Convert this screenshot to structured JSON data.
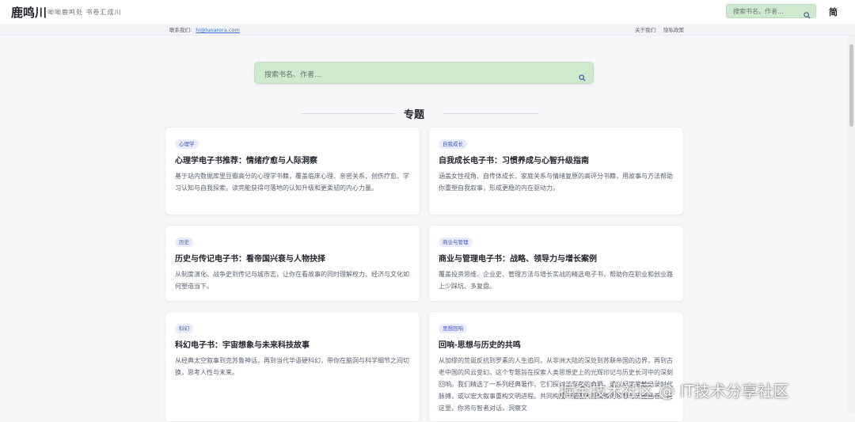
{
  "header": {
    "logo": "鹿鸣川",
    "tagline": "呦呦鹿鸣处 书卷汇成川",
    "search_placeholder": "搜索书名、作者...",
    "lang": "简"
  },
  "subbar": {
    "contact_label": "联系我们:",
    "email": "hi@lunarora.com",
    "about": "关于我们",
    "privacy": "隐私政策"
  },
  "main_search": {
    "placeholder": "搜索书名、作者..."
  },
  "section": {
    "title": "专题"
  },
  "cards": [
    {
      "tag": "心理学",
      "title": "心理学电子书推荐：情绪疗愈与人际洞察",
      "desc": "基于站内数据库里豆瓣高分的心理学书籍，覆盖临床心理、亲密关系、创伤疗愈、学习认知与自我探索。读完能获得可落地的认知升级和更柔韧的内心力量。"
    },
    {
      "tag": "自我成长",
      "title": "自我成长电子书：习惯养成与心智升级指南",
      "desc": "涵盖女性视角、自传体成长、家庭关系与情绪复原的高评分书籍，用故事与方法帮助你重塑自我叙事，形成更稳的内在驱动力。"
    },
    {
      "tag": "历史",
      "title": "历史与传记电子书：看帝国兴衰与人物抉择",
      "desc": "从制度演化、战争史到传记与城市志，让你在看故事的同时理解权力、经济与文化如何塑造当下。"
    },
    {
      "tag": "商业与管理",
      "title": "商业与管理电子书：战略、领导力与增长案例",
      "desc": "覆盖投资思维、企业史、管理方法与增长实战的精选电子书，帮助你在职业和创业路上少踩坑、多复盘。"
    },
    {
      "tag": "科幻",
      "title": "科幻电子书：宇宙想象与未来科技故事",
      "desc": "从经典太空叙事到克苏鲁神话，再到当代华语硬科幻，带你在脑洞与科学细节之间切换，思考人性与未来。"
    },
    {
      "tag": "思想回响",
      "title": "回响·思想与历史的共鸣",
      "desc": "从加缪的荒诞反抗到罗素的人生追问，从非洲大陆的深处到苏联帝国的边界，再到古老中国的风云变幻。这个专题旨在探索人类思想史上的光辉印记与历史长河中的深刻回响。我们精选了一系列经典著作，它们探讨了存在的命题，或以纪实笔触记录时代脉搏，或以宏大叙事重构文明进程。共同构成一幅宏大而精微的思想与历史画卷。在这里，你将与智者对话，洞察文"
    }
  ],
  "watermark": "掘金技术社区 @ IT技术分享社区"
}
